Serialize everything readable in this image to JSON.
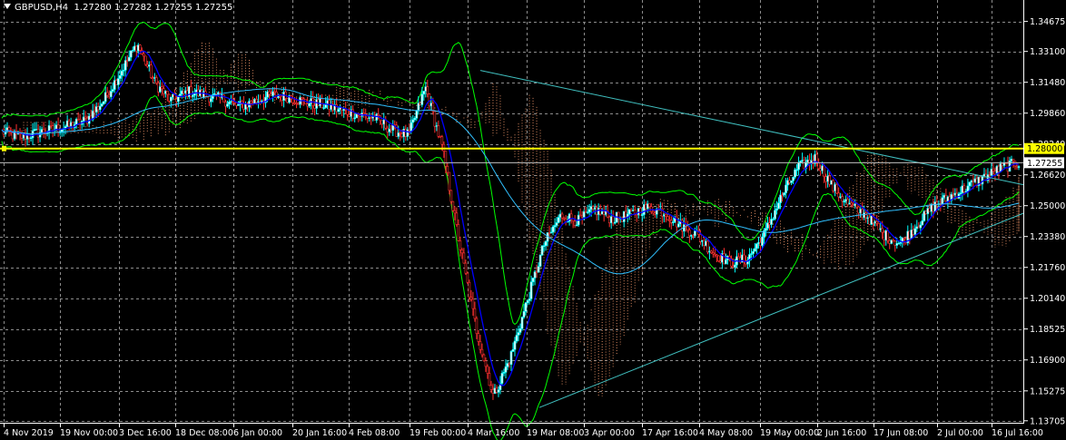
{
  "header": {
    "symbol": "GBPUSD,H4",
    "ohlc": "1.27280 1.27282 1.27255 1.27255"
  },
  "chart_data": {
    "type": "candlestick",
    "title": "GBPUSD,H4",
    "ylim": [
      1.136,
      1.358
    ],
    "y_ticks": [
      "1.34675",
      "1.33100",
      "1.31480",
      "1.29860",
      "1.28240",
      "1.26620",
      "1.25000",
      "1.23380",
      "1.21760",
      "1.20140",
      "1.18525",
      "1.16900",
      "1.15275",
      "1.13705"
    ],
    "x_ticks": [
      "4 Nov 2019",
      "19 Nov 00:00",
      "3 Dec 16:00",
      "18 Dec 08:00",
      "6 Jan 00:00",
      "20 Jan 16:00",
      "4 Feb 08:00",
      "19 Feb 00:00",
      "4 Mar 16:00",
      "19 Mar 08:00",
      "3 Apr 00:00",
      "17 Apr 16:00",
      "4 May 08:00",
      "19 May 00:00",
      "2 Jun 16:00",
      "17 Jun 08:00",
      "2 Jul 00:00",
      "16 Jul 16:00"
    ],
    "grid": true,
    "series": [
      {
        "name": "close",
        "values": [
          1.289,
          1.286,
          1.288,
          1.29,
          1.292,
          1.295,
          1.305,
          1.32,
          1.335,
          1.315,
          1.305,
          1.31,
          1.308,
          1.306,
          1.302,
          1.305,
          1.308,
          1.307,
          1.304,
          1.303,
          1.3,
          1.298,
          1.296,
          1.29,
          1.287,
          1.312,
          1.28,
          1.23,
          1.185,
          1.15,
          1.17,
          1.2,
          1.23,
          1.245,
          1.242,
          1.248,
          1.243,
          1.245,
          1.249,
          1.247,
          1.24,
          1.235,
          1.225,
          1.22,
          1.222,
          1.235,
          1.255,
          1.27,
          1.275,
          1.26,
          1.25,
          1.245,
          1.235,
          1.23,
          1.24,
          1.25,
          1.255,
          1.26,
          1.265,
          1.27,
          1.2726
        ]
      }
    ],
    "horizontal_levels": [
      {
        "value": 1.28,
        "label": "1.28000",
        "color": "#ffff00"
      },
      {
        "value": 1.27255,
        "label": "1.27255",
        "color": "#c0c0c0"
      }
    ],
    "trendlines": [
      {
        "from": [
          "4 Mar 16:00",
          1.321
        ],
        "to": [
          "16 Jul 16:00",
          1.261
        ],
        "color": "#40c0c0"
      },
      {
        "from": [
          "19 Mar 08:00",
          1.144
        ],
        "to": [
          "16 Jul 16:00",
          1.246
        ],
        "color": "#40c0c0"
      }
    ],
    "colors": {
      "background": "#000000",
      "grid": "#8c8c8c",
      "candle_up": "#00ffff",
      "candle_down": "#ff3030",
      "bollinger": "#00ff00",
      "ma_fast": "#0000ff",
      "ma_slow": "#30c0ff",
      "ichimoku_cloud": "#ffa070"
    }
  }
}
